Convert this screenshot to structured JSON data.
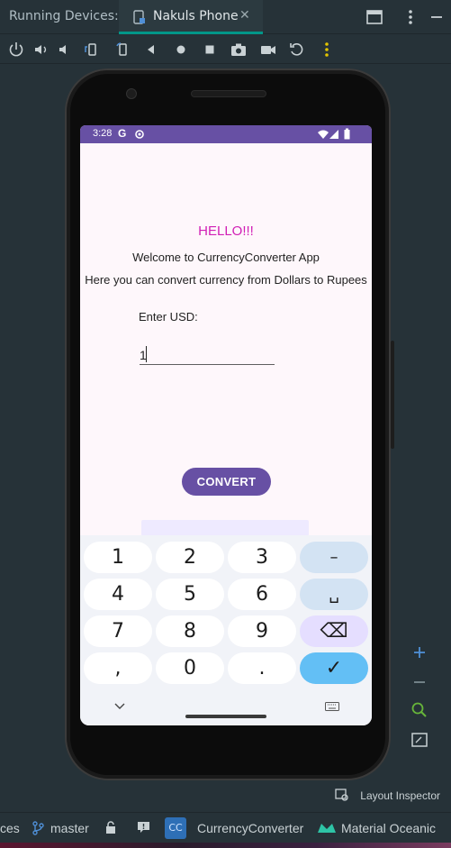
{
  "tab_bar": {
    "title": "Running Devices:",
    "tab_label": "Nakuls Phone"
  },
  "status_bar": {
    "time": "3:28",
    "g": "G"
  },
  "app": {
    "hello": "HELLO!!!",
    "welcome": "Welcome to CurrencyConverter App",
    "description": "Here you can convert currency from Dollars to Rupees",
    "enter_label": "Enter USD:",
    "usd_value": "1",
    "convert_label": "CONVERT"
  },
  "keyboard": {
    "rows": [
      [
        "1",
        "2",
        "3",
        "–"
      ],
      [
        "4",
        "5",
        "6",
        "␣"
      ],
      [
        "7",
        "8",
        "9",
        "⌫"
      ],
      [
        ",",
        "0",
        ".",
        "✓"
      ]
    ]
  },
  "layout_inspector": "Layout Inspector",
  "statusbar": {
    "left_fragment": "ces",
    "branch": "master",
    "project_badge": "CC",
    "project": "CurrencyConverter",
    "theme": "Material Oceanic"
  }
}
